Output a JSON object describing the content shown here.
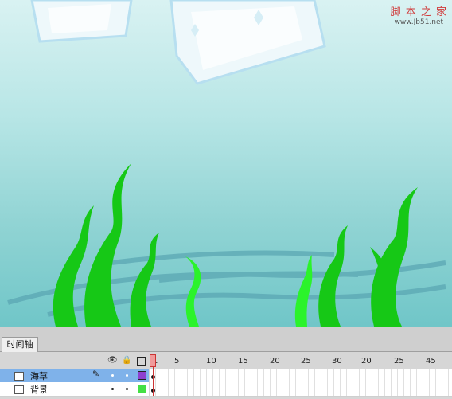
{
  "watermark": {
    "title": "脚 本 之 家",
    "url": "www.Jb51.net"
  },
  "timeline": {
    "tab_label": "时间轴",
    "frame_numbers": [
      "1",
      "5",
      "10",
      "15",
      "20",
      "25",
      "30",
      "20",
      "25",
      "45"
    ],
    "layers": [
      {
        "name": "海草",
        "selected": true,
        "color": "#8e3fcf"
      },
      {
        "name": "背景",
        "selected": false,
        "color": "#44e044"
      }
    ]
  },
  "colors": {
    "seaweed": "#16c816",
    "seaweed_light": "#2bf32b",
    "water_top": "#d9f2f2",
    "water_bottom": "#70c6c8"
  }
}
